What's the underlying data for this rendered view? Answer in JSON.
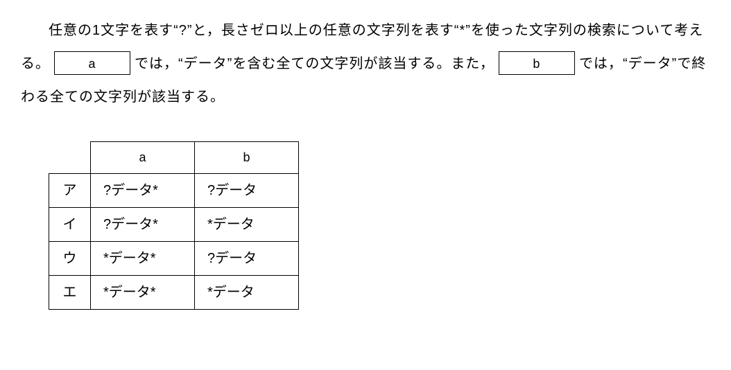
{
  "paragraph": {
    "text1_prefix": "任意の1文字を表す",
    "quoted_qmark": "“?”",
    "text2": "と，長さゼロ以上の任意の文字列を表す",
    "quoted_star": "“*”",
    "text3": "を使った文字列の検索について考える。",
    "blank_a": "a",
    "text4": "では，",
    "quoted_data1": "“データ”",
    "text5": "を含む全ての文字列が該当する。また，",
    "blank_b": "b",
    "text6": "では，",
    "quoted_data2": "“データ”",
    "text7": "で終わる全ての文字列が該当する。"
  },
  "table": {
    "headers": {
      "col_a": "a",
      "col_b": "b"
    },
    "rows": [
      {
        "label": "ア",
        "a": "?データ*",
        "b": "?データ"
      },
      {
        "label": "イ",
        "a": "?データ*",
        "b": "*データ"
      },
      {
        "label": "ウ",
        "a": "*データ*",
        "b": "?データ"
      },
      {
        "label": "エ",
        "a": "*データ*",
        "b": "*データ"
      }
    ]
  }
}
